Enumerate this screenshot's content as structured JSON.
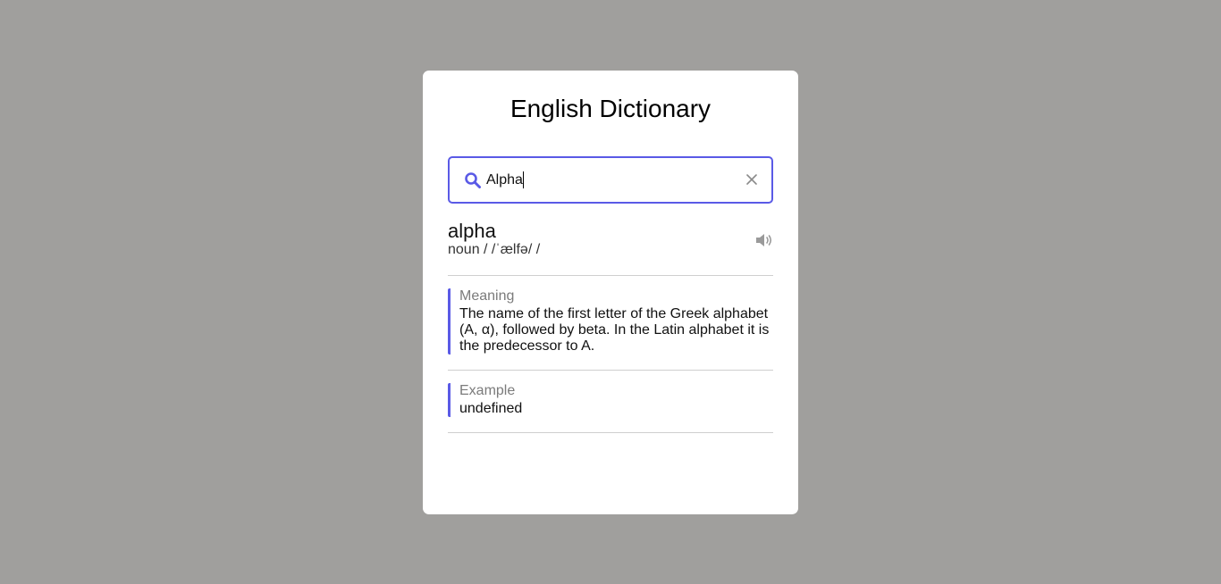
{
  "app": {
    "title": "English Dictionary"
  },
  "search": {
    "value": "Alpha",
    "placeholder": ""
  },
  "result": {
    "word": "alpha",
    "phonetic": "noun / /ˈælfə/ /",
    "meaning_label": "Meaning",
    "meaning_text": "The name of the first letter of the Greek alphabet (A, α), followed by beta. In the Latin alphabet it is the predecessor to A.",
    "example_label": "Example",
    "example_text": "undefined"
  },
  "icons": {
    "search": "search-icon",
    "clear": "close-icon",
    "speaker": "speaker-icon"
  },
  "colors": {
    "accent": "#5a5ae6",
    "background": "#a09f9d",
    "card": "#ffffff"
  }
}
